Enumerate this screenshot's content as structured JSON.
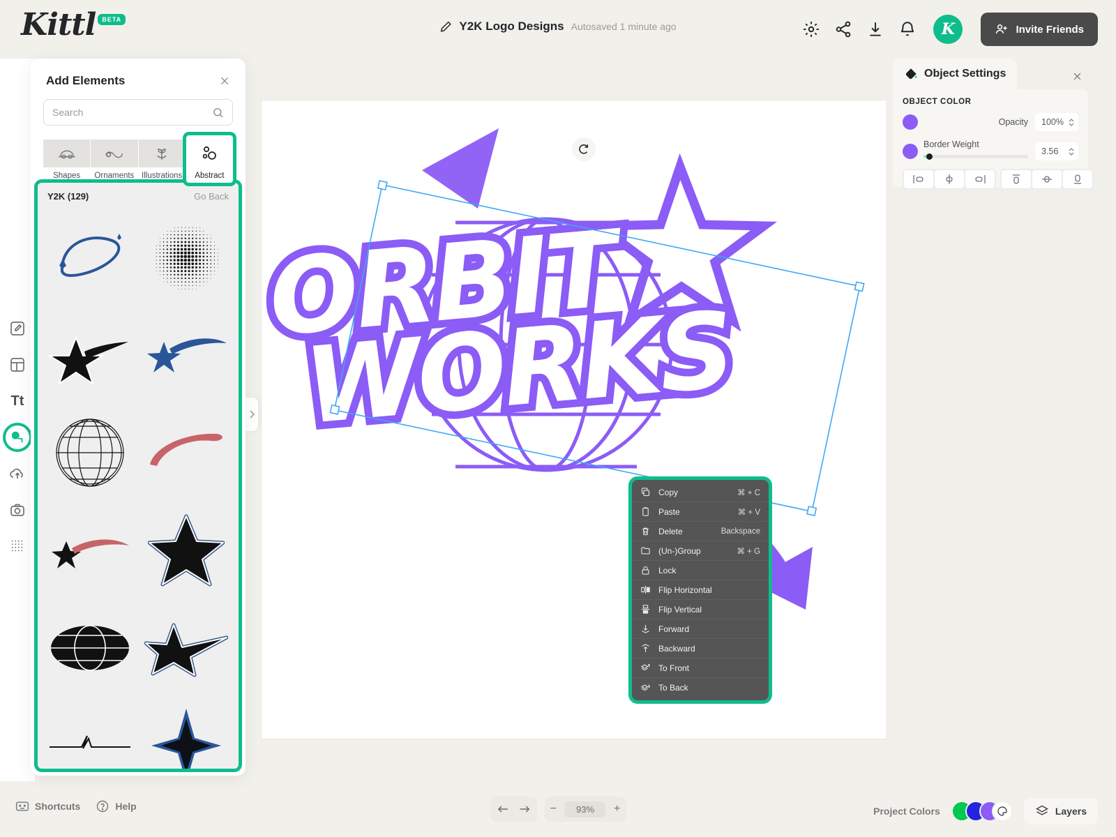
{
  "app": {
    "brand": "Kittl",
    "brand_badge": "BETA",
    "accent_teal": "#0fbd8c",
    "object_purple": "#8b5cf6",
    "canvas_bg": "#ffffff",
    "app_bg": "#f2f0ea"
  },
  "header": {
    "document_title": "Y2K Logo Designs",
    "autosave_status": "Autosaved 1 minute ago",
    "edit_icon": "pencil-icon",
    "icons": [
      {
        "name": "settings-gear-icon"
      },
      {
        "name": "share-icon"
      },
      {
        "name": "download-icon"
      },
      {
        "name": "notifications-bell-icon"
      }
    ],
    "avatar_letter": "K",
    "invite_label": "Invite Friends",
    "invite_icon": "add-user-icon"
  },
  "left_rail": {
    "items": [
      {
        "name": "design-edit-icon",
        "active": false
      },
      {
        "name": "templates-icon",
        "active": false
      },
      {
        "name": "text-icon",
        "label": "Tt",
        "active": false
      },
      {
        "name": "elements-icon",
        "active": true
      },
      {
        "name": "uploads-icon",
        "active": false
      },
      {
        "name": "photos-camera-icon",
        "active": false
      },
      {
        "name": "patterns-grid-icon",
        "active": false
      }
    ]
  },
  "elements_panel": {
    "title": "Add Elements",
    "close_icon": "close-icon",
    "search": {
      "placeholder": "Search",
      "value": "",
      "icon": "search-icon"
    },
    "tabs": [
      {
        "label": "Shapes",
        "icon": "shapes-icon",
        "selected": false
      },
      {
        "label": "Ornaments",
        "icon": "ornaments-icon",
        "selected": false
      },
      {
        "label": "Illustrations",
        "icon": "illustrations-icon",
        "selected": false
      },
      {
        "label": "Abstract",
        "icon": "abstract-icon",
        "selected": true
      }
    ],
    "results": {
      "category_label": "Y2K (129)",
      "go_back_label": "Go Back",
      "assets": [
        {
          "name": "asset-orbit-swoosh-blue"
        },
        {
          "name": "asset-halftone-dot-circle"
        },
        {
          "name": "asset-star-with-trail-black"
        },
        {
          "name": "asset-shooting-star-blue"
        },
        {
          "name": "asset-wireframe-globe"
        },
        {
          "name": "asset-ellipse-swoosh-red"
        },
        {
          "name": "asset-comet-star-red"
        },
        {
          "name": "asset-outlined-star-black"
        },
        {
          "name": "asset-solid-ellipse-globe"
        },
        {
          "name": "asset-star-trail-outlined"
        },
        {
          "name": "asset-zigzag-line"
        },
        {
          "name": "asset-four-point-star-blue"
        }
      ]
    },
    "collapse_icon": "chevron-right-icon"
  },
  "canvas": {
    "logo_line1": "ORBIT",
    "logo_line2": "WORKS",
    "logo_color": "#8b5cf6",
    "rotate_handle_icon": "rotate-icon",
    "selection_color": "#3ea8f5"
  },
  "context_menu": {
    "items": [
      {
        "label": "Copy",
        "shortcut": "⌘ + C",
        "icon": "copy-icon"
      },
      {
        "label": "Paste",
        "shortcut": "⌘ + V",
        "icon": "paste-icon"
      },
      {
        "label": "Delete",
        "shortcut": "Backspace",
        "icon": "trash-icon"
      },
      {
        "label": "(Un-)Group",
        "shortcut": "⌘ + G",
        "icon": "folder-icon"
      },
      {
        "label": "Lock",
        "shortcut": "",
        "icon": "lock-icon"
      },
      {
        "label": "Flip Horizontal",
        "shortcut": "",
        "icon": "flip-horizontal-icon"
      },
      {
        "label": "Flip Vertical",
        "shortcut": "",
        "icon": "flip-vertical-icon"
      },
      {
        "label": "Forward",
        "shortcut": "",
        "icon": "forward-icon"
      },
      {
        "label": "Backward",
        "shortcut": "",
        "icon": "backward-icon"
      },
      {
        "label": "To Front",
        "shortcut": "",
        "icon": "to-front-icon"
      },
      {
        "label": "To Back",
        "shortcut": "",
        "icon": "to-back-icon"
      }
    ]
  },
  "object_settings": {
    "title": "Object Settings",
    "title_icon": "paint-bucket-icon",
    "close_icon": "close-icon",
    "section_label": "OBJECT COLOR",
    "fill_swatch": "#8b5cf6",
    "border_swatch": "#8b5cf6",
    "opacity_label": "Opacity",
    "opacity_value": "100%",
    "border_weight_label": "Border Weight",
    "border_weight_value": "3.56",
    "align_buttons": [
      {
        "name": "align-left-icon"
      },
      {
        "name": "align-center-horizontal-icon"
      },
      {
        "name": "align-right-icon"
      },
      {
        "name": "align-top-icon"
      },
      {
        "name": "align-center-vertical-icon"
      },
      {
        "name": "align-bottom-icon"
      }
    ]
  },
  "footer": {
    "shortcuts_label": "Shortcuts",
    "shortcuts_icon": "keyboard-icon",
    "help_label": "Help",
    "help_icon": "question-circle-icon",
    "undo_icon": "undo-icon",
    "redo_icon": "redo-icon",
    "zoom_out_label": "−",
    "zoom_value": "93%",
    "zoom_in_label": "+",
    "project_colors_label": "Project Colors",
    "project_colors": [
      "#00c853",
      "#2323e0",
      "#8b5cf6"
    ],
    "palette_icon": "color-palette-icon",
    "layers_label": "Layers",
    "layers_icon": "layers-icon"
  }
}
